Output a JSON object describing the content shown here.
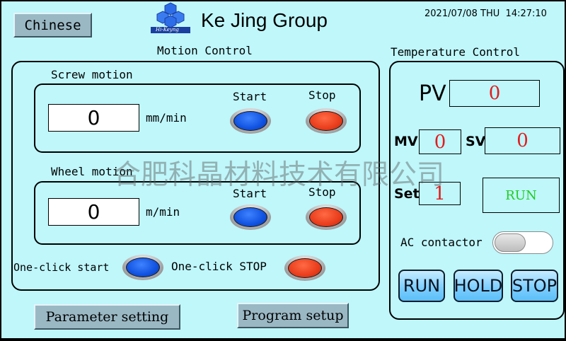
{
  "header": {
    "language_button": "Chinese",
    "logo_text": "Hi-Keyng",
    "company": "Ke Jing Group",
    "datetime": "2021/07/08 THU  14:27:10"
  },
  "watermark": "合肥科晶材料技术有限公司",
  "motion": {
    "title": "Motion Control",
    "screw": {
      "title": "Screw motion",
      "value": "0",
      "unit": "mm/min",
      "start_label": "Start",
      "stop_label": "Stop"
    },
    "wheel": {
      "title": "Wheel motion",
      "value": "0",
      "unit": "m/min",
      "start_label": "Start",
      "stop_label": "Stop"
    },
    "one_click_start": "One-click start",
    "one_click_stop": "One-click STOP"
  },
  "temperature": {
    "title": "Temperature Control",
    "pv_label": "PV",
    "pv_value": "0",
    "mv_label": "MV",
    "mv_value": "0",
    "sv_label": "SV",
    "sv_value": "0",
    "set_label": "Set",
    "set_value": "1",
    "status": "RUN",
    "ac_label": "AC contactor",
    "ac_on": false,
    "buttons": [
      "RUN",
      "HOLD",
      "STOP"
    ]
  },
  "footer": {
    "parameter_button": "Parameter setting",
    "program_button": "Program setup"
  },
  "colors": {
    "background": "#bff7fb",
    "start_button": "#1052e0",
    "stop_button": "#e93d1c",
    "value_red": "#e21d1d",
    "status_green": "#22cc22"
  }
}
